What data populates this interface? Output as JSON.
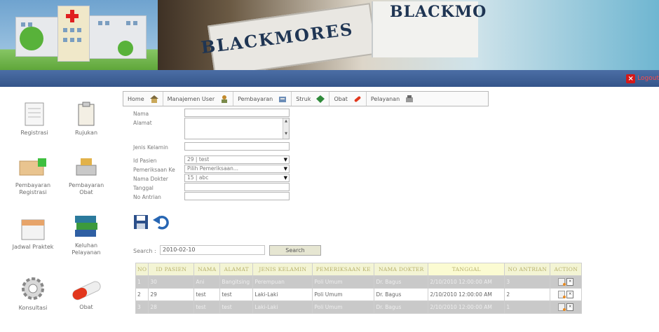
{
  "header": {
    "brand_left": "BLACKMORES",
    "brand_right": "BLACKMO",
    "logout_label": "Logout"
  },
  "sidebar": {
    "items": [
      {
        "label": "Registrasi",
        "icon": "notepad-icon"
      },
      {
        "label": "Rujukan",
        "icon": "clipboard-icon"
      },
      {
        "label": "Pembayaran Registrasi",
        "icon": "payment-hand-icon"
      },
      {
        "label": "Pembayaran Obat",
        "icon": "payment-card-icon"
      },
      {
        "label": "Jadwal Praktek",
        "icon": "calendar-icon"
      },
      {
        "label": "Keluhan Pelayanan",
        "icon": "books-icon"
      },
      {
        "label": "Konsultasi",
        "icon": "gear-icon"
      },
      {
        "label": "Obat",
        "icon": "pill-icon"
      }
    ]
  },
  "nav": {
    "items": [
      {
        "label": "Home",
        "icon": "home-icon"
      },
      {
        "label": "Manajemen User",
        "icon": "users-icon"
      },
      {
        "label": "Pembayaran",
        "icon": "payment-icon"
      },
      {
        "label": "Struk",
        "icon": "receipt-icon"
      },
      {
        "label": "Obat",
        "icon": "pill-icon"
      },
      {
        "label": "Pelayanan",
        "icon": "service-icon"
      }
    ]
  },
  "form": {
    "nama_label": "Nama",
    "alamat_label": "Alamat",
    "jenis_kelamin_label": "Jenis Kelamin",
    "id_pasien_label": "Id Pasien",
    "id_pasien_value": "29 | test",
    "pemeriksaan_label": "Pemeriksaan Ke",
    "pemeriksaan_value": "Pilih Pemeriksaan...",
    "nama_dokter_label": "Nama Dokter",
    "nama_dokter_value": "15 | abc",
    "tanggal_label": "Tanggal",
    "no_antrian_label": "No Antrian"
  },
  "search": {
    "label": "Search :",
    "value": "2010-02-10",
    "button_label": "Search"
  },
  "table": {
    "columns": [
      "NO",
      "ID PASIEN",
      "NAMA",
      "ALAMAT",
      "JENIS KELAMIN",
      "PEMERIKSAAN KE",
      "NAMA DOKTER",
      "TANGGAL",
      "NO ANTRIAN",
      "ACTION"
    ],
    "rows": [
      [
        "1",
        "30",
        "Ani",
        "Bangitsing",
        "Perempuan",
        "Poli Umum",
        "Dr. Bagus",
        "2/10/2010 12:00:00 AM",
        "3"
      ],
      [
        "2",
        "29",
        "test",
        "test",
        "Laki-Laki",
        "Poli Umum",
        "Dr. Bagus",
        "2/10/2010 12:00:00 AM",
        "2"
      ],
      [
        "3",
        "28",
        "test",
        "test",
        "Laki-Laki",
        "Poli Umum",
        "Dr. Bagus",
        "2/10/2010 12:00:00 AM",
        "1"
      ]
    ]
  }
}
